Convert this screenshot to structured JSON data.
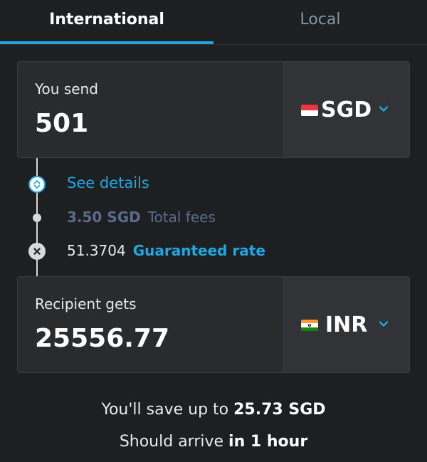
{
  "tabs": {
    "international": "International",
    "local": "Local"
  },
  "send": {
    "label": "You send",
    "amount": "501",
    "currency": "SGD"
  },
  "breakdown": {
    "see_details": "See details",
    "fee_amount": "3.50 SGD",
    "fee_label": "Total fees",
    "rate_value": "51.3704",
    "rate_label": "Guaranteed rate"
  },
  "receive": {
    "label": "Recipient gets",
    "amount": "25556.77",
    "currency": "INR"
  },
  "summary": {
    "save_prefix": "You'll save up to ",
    "save_amount": "25.73 SGD",
    "arrive_prefix": "Should arrive ",
    "arrive_time": "in 1 hour"
  },
  "colors": {
    "accent": "#1ea7e1",
    "background": "#1e1f21",
    "card": "#2a2b2d",
    "fee_text": "#5b6b8c"
  },
  "icons": {
    "details_node": "expand-icon",
    "rate_node": "times-icon",
    "dropdown": "chevron-down-icon"
  }
}
